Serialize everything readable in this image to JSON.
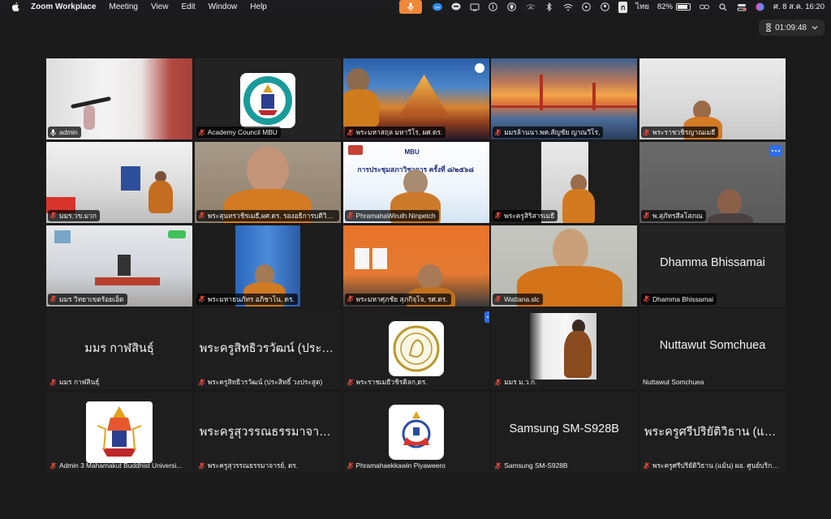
{
  "menubar": {
    "app_name": "Zoom Workplace",
    "menus": [
      "Meeting",
      "View",
      "Edit",
      "Window",
      "Help"
    ],
    "input_source": "ไทย",
    "battery": "82%",
    "datetime": "ศ. 8 ส.ค.  16:20",
    "zm_badge": "zm"
  },
  "meeting": {
    "timer": "01:09:48",
    "accent_active": "#3cd370",
    "accent_menu": "#2c6ef2",
    "mute_color": "#e0453a"
  },
  "participants": [
    {
      "name": "admin",
      "muted": false,
      "kind": "video",
      "active": true
    },
    {
      "name": "Academy Council MBU",
      "muted": true,
      "kind": "logo"
    },
    {
      "name": "พระมหาสฤล มหาวีโร, ผศ.ดร.",
      "muted": true,
      "kind": "video"
    },
    {
      "name": "มมรล้านนา.พค.สัญชัย ญาณวีโร,",
      "muted": true,
      "kind": "video"
    },
    {
      "name": "พระราชวชิรญาณเมธี",
      "muted": true,
      "kind": "video"
    },
    {
      "name": "มมร.วข.มวก",
      "muted": true,
      "kind": "video"
    },
    {
      "name": "พระสุนทรวชิรเมธี,ผศ.ดร. รองอธิการบดีวิทย...",
      "muted": true,
      "kind": "video"
    },
    {
      "name": "PhramahaWiruth Ninpetch",
      "muted": true,
      "kind": "video",
      "slide_title": "การประชุมสภาวิชาการ ครั้งที่ ๘/๒๕๖๘",
      "slide_brand": "MBU"
    },
    {
      "name": "พระครูสิริสารเมธี",
      "muted": true,
      "kind": "video"
    },
    {
      "name": "พ.สุภัทรสีลโสภณ",
      "muted": true,
      "kind": "video",
      "more": true
    },
    {
      "name": "มมร วิทยาเขตร้อยเอ็ด",
      "muted": true,
      "kind": "video"
    },
    {
      "name": "พระมหาธนภัทร อภิชาโน, ดร.",
      "muted": true,
      "kind": "video"
    },
    {
      "name": "พระมหาศุภชัย สุภกิจฺโจ, รศ.ดร.",
      "muted": true,
      "kind": "video"
    },
    {
      "name": "Wattana.slc",
      "muted": true,
      "kind": "video"
    },
    {
      "name": "Dhamma Bhissamai",
      "muted": true,
      "kind": "name",
      "label_plain": false
    },
    {
      "name": "มมร กาฬสินธุ์",
      "muted": true,
      "kind": "name",
      "label_plain": true
    },
    {
      "name": "พระครูสิทธิวรวัฒน์ (ประสิทธิ์ วงประสูต)",
      "display": "พระครูสิทธิวรวัฒน์ (ประสิ...",
      "muted": true,
      "kind": "name",
      "label_plain": true
    },
    {
      "name": "พระราชเมธีวชิรดิลก,ดร.",
      "muted": true,
      "kind": "logo",
      "more": true
    },
    {
      "name": "มมร ม.ว.ก.",
      "muted": true,
      "kind": "video"
    },
    {
      "name": "Nuttawut Somchuea",
      "muted": false,
      "kind": "name",
      "label_plain": true
    },
    {
      "name": "Admin 3 Mahamakut Buddhist Universi...",
      "muted": true,
      "kind": "logo"
    },
    {
      "name": "พระครูสุวรรณธรรมาจารย์, ดร.",
      "display": "พระครูสุวรรณธรรมาจารย์...",
      "muted": true,
      "kind": "name",
      "label_plain": true
    },
    {
      "name": "Phramahaekkawin Piyaweero",
      "muted": true,
      "kind": "logo"
    },
    {
      "name": "Samsung SM-S928B",
      "muted": true,
      "kind": "name",
      "label_plain": true
    },
    {
      "name": "พระครูศรีปริยัติวิธาน (แม้น) ผอ. ศูนย์บริการ...",
      "display": "พระครูศรีปริยัติวิธาน (แม้...",
      "muted": true,
      "kind": "name",
      "label_plain": true
    }
  ]
}
